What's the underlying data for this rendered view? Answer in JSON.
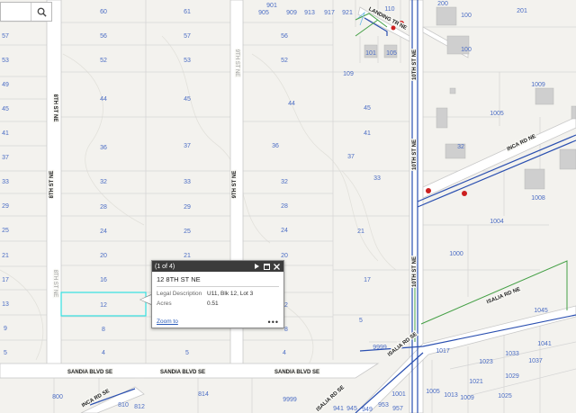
{
  "search": {
    "value": ""
  },
  "streets": {
    "s8th_upper": "8TH ST NE",
    "s8th_lower": "8TH ST NE",
    "s9th": "9TH ST NE",
    "s10th_upper": "10TH ST NE",
    "s10th_mid": "10TH ST NE",
    "s10th_lower": "10TH ST NE",
    "landing": "LANDING TR NE",
    "inca_ne": "INCA RD NE",
    "inca_se": "INCA RD SE",
    "sandia1": "SANDIA BLVD SE",
    "sandia2": "SANDIA BLVD SE",
    "sandia3": "SANDIA BLVD SE",
    "isalia_ne": "ISALIA RD NE",
    "isalia_se1": "ISALIA RD SE",
    "isalia_se2": "ISALIA RD SE"
  },
  "lots": {
    "a60": "60",
    "a56": "56",
    "a52": "52",
    "a44": "44",
    "a36": "36",
    "a32": "32",
    "a28": "28",
    "a24": "24",
    "a20": "20",
    "a16": "16",
    "a12": "12",
    "a8": "8",
    "a4": "4",
    "b61": "61",
    "b57": "57",
    "b53": "53",
    "b45": "45",
    "b37": "37",
    "b33": "33",
    "b29": "29",
    "b25": "25",
    "b21": "21",
    "b5": "5",
    "c57": "57",
    "c53": "53",
    "c49": "49",
    "c45": "45",
    "c41": "41",
    "c37": "37",
    "c33": "33",
    "c29": "29",
    "c25": "25",
    "c21": "21",
    "c17": "17",
    "c13": "13",
    "c9": "9",
    "c5": "5",
    "d56": "56",
    "d52": "52",
    "d44": "44",
    "d36": "36",
    "d32": "32",
    "d28": "28",
    "d24": "24",
    "d20": "20",
    "d2": "2",
    "d8": "8",
    "d4": "4",
    "e45": "45",
    "e41": "41",
    "e37": "37",
    "e33": "33",
    "e21": "21",
    "e17": "17",
    "e5": "5",
    "e109": "109",
    "n901": "901",
    "n905": "905",
    "n909": "909",
    "n913": "913",
    "n917": "917",
    "n921": "921",
    "n110": "110",
    "n101": "101",
    "n105": "105",
    "n9999a": "9999",
    "n9999b": "9999",
    "r200": "200",
    "r100": "100",
    "r201": "201",
    "r1009": "1009",
    "r1005": "1005",
    "r32": "32",
    "r1008": "1008",
    "r1004": "1004",
    "r1000": "1000",
    "r1045": "1045",
    "r1041": "1041",
    "r1037": "1037",
    "r1033": "1033",
    "r1029": "1029",
    "r1025": "1025",
    "r1023": "1023",
    "r1021": "1021",
    "r1017": "1017",
    "r1013": "1013",
    "r1009b": "1009",
    "r1005b": "1005",
    "r1001": "1001",
    "s800": "800",
    "s814": "814",
    "s810": "810",
    "s812": "812",
    "s941": "941",
    "s945": "945",
    "s953": "953",
    "s949": "949",
    "s957": "957"
  },
  "popup": {
    "count": "(1 of 4)",
    "title": "12 8TH ST NE",
    "legal_label": "Legal Description",
    "legal_value": "U11, Blk 12, Lot 3",
    "acres_label": "Acres",
    "acres_value": "0.51",
    "zoom_label": "Zoom to",
    "more_label": "•••"
  },
  "colors": {
    "road_casing": "#c8c8c8",
    "lot_line": "#d6d6d6",
    "water_main": "#2a4fb0",
    "sewer": "#45a046",
    "hydrant": "#cc1f1f",
    "selection": "#33e0e0"
  }
}
